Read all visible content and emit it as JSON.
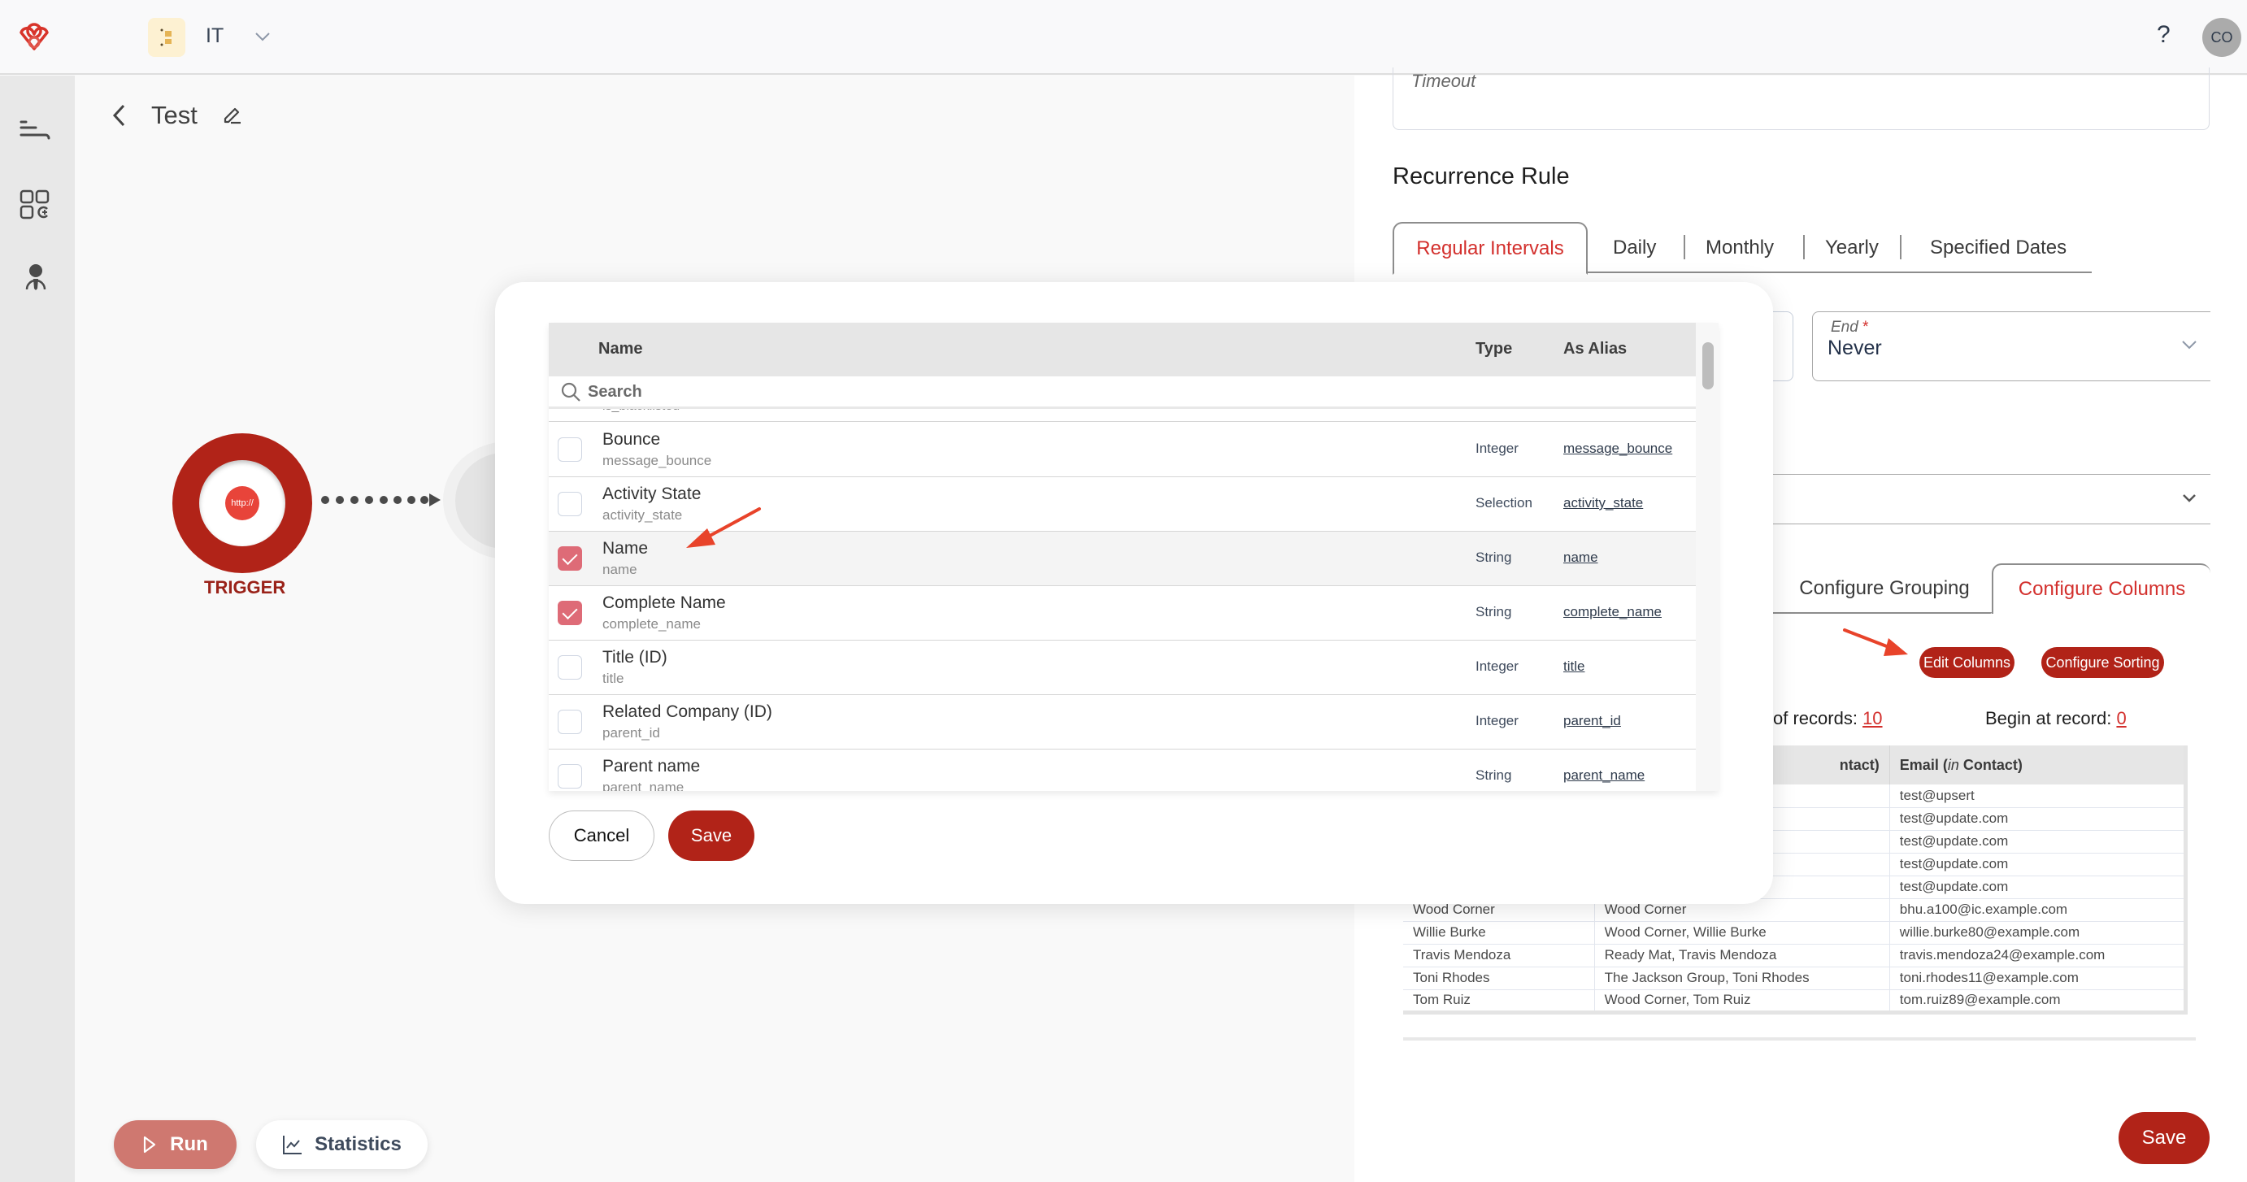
{
  "header": {
    "workspace_name": "IT",
    "help_label": "?",
    "avatar_initials": "CO"
  },
  "sidebar": {
    "items": [
      {
        "icon": "flows-icon"
      },
      {
        "icon": "apps-add-icon"
      },
      {
        "icon": "agent-icon"
      }
    ]
  },
  "canvas": {
    "title": "Test",
    "trigger_core_label": "http://",
    "trigger_label": "TRIGGER",
    "run_label": "Run",
    "statistics_label": "Statistics"
  },
  "right_panel": {
    "timeout_label": "Timeout",
    "recurrence_title": "Recurrence Rule",
    "recurrence_tabs": [
      "Regular Intervals",
      "Daily",
      "Monthly",
      "Yearly",
      "Specified Dates"
    ],
    "recurrence_active_tab": "Regular Intervals",
    "end_field": {
      "label": "End",
      "required_mark": "*",
      "value": "Never"
    },
    "config_tabs": [
      "Configure Grouping",
      "Configure Columns"
    ],
    "config_active_tab": "Configure Columns",
    "edit_columns_label": "Edit Columns",
    "configure_sorting_label": "Configure Sorting",
    "records_label": "of records:",
    "records_value": "10",
    "begin_label": "Begin at record:",
    "begin_value": "0",
    "table": {
      "headers": [
        "",
        "ntact)",
        "Email (in Contact)"
      ],
      "email_header_prefix": "Email (",
      "email_header_italic": "in",
      "email_header_suffix": " Contact)",
      "rows": [
        [
          "",
          "",
          "test@upsert"
        ],
        [
          "",
          "",
          "test@update.com"
        ],
        [
          "",
          "",
          "test@update.com"
        ],
        [
          "",
          "",
          "test@update.com"
        ],
        [
          "",
          "",
          "test@update.com"
        ],
        [
          "Wood Corner",
          "Wood Corner",
          "bhu.a100@ic.example.com"
        ],
        [
          "Willie Burke",
          "Wood Corner, Willie Burke",
          "willie.burke80@example.com"
        ],
        [
          "Travis Mendoza",
          "Ready Mat, Travis Mendoza",
          "travis.mendoza24@example.com"
        ],
        [
          "Toni Rhodes",
          "The Jackson Group, Toni Rhodes",
          "toni.rhodes11@example.com"
        ],
        [
          "Tom Ruiz",
          "Wood Corner, Tom Ruiz",
          "tom.ruiz89@example.com"
        ]
      ]
    },
    "save_label": "Save"
  },
  "modal": {
    "columns": {
      "name": "Name",
      "type": "Type",
      "alias": "As Alias"
    },
    "search_placeholder": "Search",
    "partial_top_key": "is_blacklisted",
    "fields": [
      {
        "label": "Bounce",
        "key": "message_bounce",
        "type": "Integer",
        "alias": "message_bounce",
        "checked": false
      },
      {
        "label": "Activity State",
        "key": "activity_state",
        "type": "Selection",
        "alias": "activity_state",
        "checked": false
      },
      {
        "label": "Name",
        "key": "name",
        "type": "String",
        "alias": "name",
        "checked": true
      },
      {
        "label": "Complete Name",
        "key": "complete_name",
        "type": "String",
        "alias": "complete_name",
        "checked": true
      },
      {
        "label": "Title (ID)",
        "key": "title",
        "type": "Integer",
        "alias": "title",
        "checked": false
      },
      {
        "label": "Related Company (ID)",
        "key": "parent_id",
        "type": "Integer",
        "alias": "parent_id",
        "checked": false
      },
      {
        "label": "Parent name",
        "key": "parent_name",
        "type": "String",
        "alias": "parent_name",
        "checked": false
      }
    ],
    "cancel_label": "Cancel",
    "save_label": "Save"
  },
  "colors": {
    "brand_red": "#b12318",
    "accent_red": "#d3302d",
    "checkbox_checked": "#de6b77",
    "run_button": "#cf7870"
  }
}
